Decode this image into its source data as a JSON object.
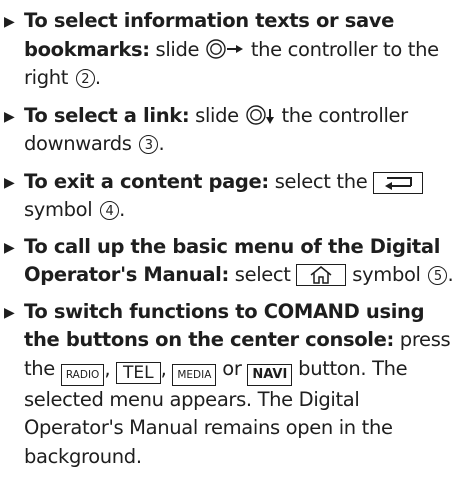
{
  "items": [
    {
      "bold": "To select information texts or save bookmarks:",
      "text1": " slide ",
      "control_icon": "controller-knob-right-arrow-icon",
      "text2": " the controller to the right ",
      "callout": "2",
      "text3": "."
    },
    {
      "bold": "To select a link:",
      "text1": " slide ",
      "control_icon": "controller-knob-down-arrow-icon",
      "text2": " the controller downwards ",
      "callout": "3",
      "text3": "."
    },
    {
      "bold": "To exit a content page:",
      "text1": " select the ",
      "symbol_icon": "back-arrow-icon",
      "text2": " symbol ",
      "callout": "4",
      "text3": "."
    },
    {
      "bold": "To call up the basic menu of the Digital Operator's Manual:",
      "text1": " select ",
      "symbol_icon": "home-icon",
      "text2": " symbol ",
      "callout": "5",
      "text3": "."
    },
    {
      "bold": "To switch functions to COMAND using the buttons on the center console:",
      "text1": " press the ",
      "key_radio": "RADIO",
      "sep1": ", ",
      "key_tel": "TEL",
      "sep2": ", ",
      "key_media": "MEDIA",
      "sep3": " or ",
      "key_navi": "NAVI",
      "text2": " button. The selected menu appears. The Digital Operator's Manual remains open in the background."
    }
  ]
}
